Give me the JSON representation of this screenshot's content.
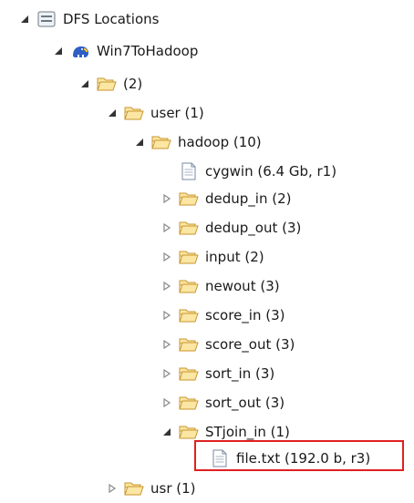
{
  "tree": [
    {
      "id": "dfs-locations",
      "label": "DFS Locations",
      "expander": "expanded",
      "icon": "server-icon"
    },
    {
      "id": "win7tohadoop",
      "label": "Win7ToHadoop",
      "expander": "expanded",
      "icon": "hadoop-elephant-icon"
    },
    {
      "id": "root",
      "label": "(2)",
      "expander": "expanded",
      "icon": "folder-open-icon"
    },
    {
      "id": "user",
      "label": "user (1)",
      "expander": "expanded",
      "icon": "folder-open-icon"
    },
    {
      "id": "hadoop",
      "label": "hadoop (10)",
      "expander": "expanded",
      "icon": "folder-open-icon"
    },
    {
      "id": "cygwin",
      "label": "cygwin (6.4 Gb, r1)",
      "expander": "none",
      "icon": "file-icon"
    },
    {
      "id": "dedup-in",
      "label": "dedup_in (2)",
      "expander": "collapsed",
      "icon": "folder-open-icon"
    },
    {
      "id": "dedup-out",
      "label": "dedup_out (3)",
      "expander": "collapsed",
      "icon": "folder-open-icon"
    },
    {
      "id": "input",
      "label": "input (2)",
      "expander": "collapsed",
      "icon": "folder-open-icon"
    },
    {
      "id": "newout",
      "label": "newout (3)",
      "expander": "collapsed",
      "icon": "folder-open-icon"
    },
    {
      "id": "score-in",
      "label": "score_in (3)",
      "expander": "collapsed",
      "icon": "folder-open-icon"
    },
    {
      "id": "score-out",
      "label": "score_out (3)",
      "expander": "collapsed",
      "icon": "folder-open-icon"
    },
    {
      "id": "sort-in",
      "label": "sort_in (3)",
      "expander": "collapsed",
      "icon": "folder-open-icon"
    },
    {
      "id": "sort-out",
      "label": "sort_out (3)",
      "expander": "collapsed",
      "icon": "folder-open-icon"
    },
    {
      "id": "stjoin-in",
      "label": "STjoin_in (1)",
      "expander": "expanded",
      "icon": "folder-open-icon"
    },
    {
      "id": "file-txt",
      "label": "file.txt (192.0 b, r3)",
      "expander": "none",
      "icon": "file-icon",
      "highlighted": true
    },
    {
      "id": "usr",
      "label": "usr (1)",
      "expander": "collapsed",
      "icon": "folder-open-icon"
    }
  ],
  "colors": {
    "highlight_border": "#e02020",
    "folder_fill": "#fbe6a3",
    "folder_stroke": "#c8962e"
  }
}
